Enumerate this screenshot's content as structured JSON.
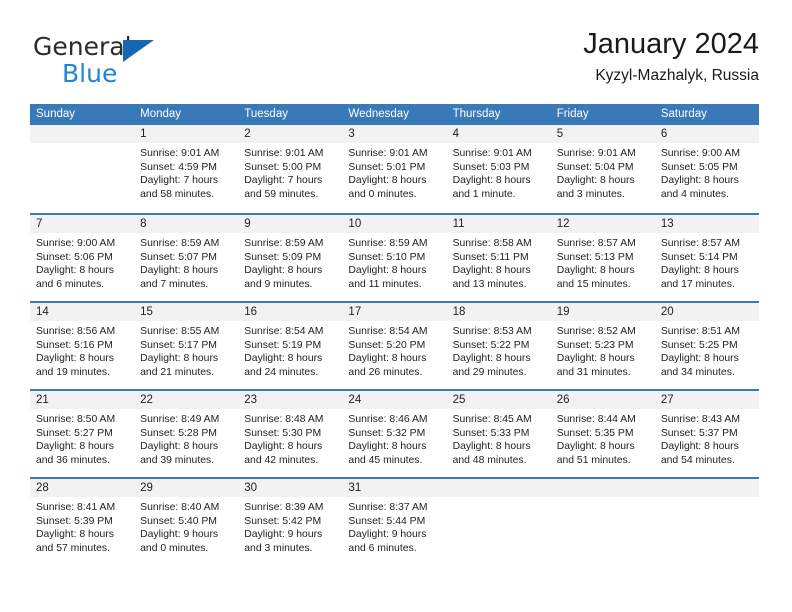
{
  "brand": {
    "name_top": "General",
    "name_bottom": "Blue",
    "triangle_color": "#1567b3",
    "blue_color": "#1f86d4"
  },
  "header": {
    "title": "January 2024",
    "subtitle": "Kyzyl-Mazhalyk, Russia"
  },
  "theme": {
    "header_bg": "#3a79b8",
    "date_band_bg": "#f2f2f2",
    "cell_bg": "#ffffff",
    "text": "#222222"
  },
  "weekdays": [
    "Sunday",
    "Monday",
    "Tuesday",
    "Wednesday",
    "Thursday",
    "Friday",
    "Saturday"
  ],
  "weeks": [
    [
      {
        "day": "",
        "lines": []
      },
      {
        "day": "1",
        "lines": [
          "Sunrise: 9:01 AM",
          "Sunset: 4:59 PM",
          "Daylight: 7 hours",
          "and 58 minutes."
        ]
      },
      {
        "day": "2",
        "lines": [
          "Sunrise: 9:01 AM",
          "Sunset: 5:00 PM",
          "Daylight: 7 hours",
          "and 59 minutes."
        ]
      },
      {
        "day": "3",
        "lines": [
          "Sunrise: 9:01 AM",
          "Sunset: 5:01 PM",
          "Daylight: 8 hours",
          "and 0 minutes."
        ]
      },
      {
        "day": "4",
        "lines": [
          "Sunrise: 9:01 AM",
          "Sunset: 5:03 PM",
          "Daylight: 8 hours",
          "and 1 minute."
        ]
      },
      {
        "day": "5",
        "lines": [
          "Sunrise: 9:01 AM",
          "Sunset: 5:04 PM",
          "Daylight: 8 hours",
          "and 3 minutes."
        ]
      },
      {
        "day": "6",
        "lines": [
          "Sunrise: 9:00 AM",
          "Sunset: 5:05 PM",
          "Daylight: 8 hours",
          "and 4 minutes."
        ]
      }
    ],
    [
      {
        "day": "7",
        "lines": [
          "Sunrise: 9:00 AM",
          "Sunset: 5:06 PM",
          "Daylight: 8 hours",
          "and 6 minutes."
        ]
      },
      {
        "day": "8",
        "lines": [
          "Sunrise: 8:59 AM",
          "Sunset: 5:07 PM",
          "Daylight: 8 hours",
          "and 7 minutes."
        ]
      },
      {
        "day": "9",
        "lines": [
          "Sunrise: 8:59 AM",
          "Sunset: 5:09 PM",
          "Daylight: 8 hours",
          "and 9 minutes."
        ]
      },
      {
        "day": "10",
        "lines": [
          "Sunrise: 8:59 AM",
          "Sunset: 5:10 PM",
          "Daylight: 8 hours",
          "and 11 minutes."
        ]
      },
      {
        "day": "11",
        "lines": [
          "Sunrise: 8:58 AM",
          "Sunset: 5:11 PM",
          "Daylight: 8 hours",
          "and 13 minutes."
        ]
      },
      {
        "day": "12",
        "lines": [
          "Sunrise: 8:57 AM",
          "Sunset: 5:13 PM",
          "Daylight: 8 hours",
          "and 15 minutes."
        ]
      },
      {
        "day": "13",
        "lines": [
          "Sunrise: 8:57 AM",
          "Sunset: 5:14 PM",
          "Daylight: 8 hours",
          "and 17 minutes."
        ]
      }
    ],
    [
      {
        "day": "14",
        "lines": [
          "Sunrise: 8:56 AM",
          "Sunset: 5:16 PM",
          "Daylight: 8 hours",
          "and 19 minutes."
        ]
      },
      {
        "day": "15",
        "lines": [
          "Sunrise: 8:55 AM",
          "Sunset: 5:17 PM",
          "Daylight: 8 hours",
          "and 21 minutes."
        ]
      },
      {
        "day": "16",
        "lines": [
          "Sunrise: 8:54 AM",
          "Sunset: 5:19 PM",
          "Daylight: 8 hours",
          "and 24 minutes."
        ]
      },
      {
        "day": "17",
        "lines": [
          "Sunrise: 8:54 AM",
          "Sunset: 5:20 PM",
          "Daylight: 8 hours",
          "and 26 minutes."
        ]
      },
      {
        "day": "18",
        "lines": [
          "Sunrise: 8:53 AM",
          "Sunset: 5:22 PM",
          "Daylight: 8 hours",
          "and 29 minutes."
        ]
      },
      {
        "day": "19",
        "lines": [
          "Sunrise: 8:52 AM",
          "Sunset: 5:23 PM",
          "Daylight: 8 hours",
          "and 31 minutes."
        ]
      },
      {
        "day": "20",
        "lines": [
          "Sunrise: 8:51 AM",
          "Sunset: 5:25 PM",
          "Daylight: 8 hours",
          "and 34 minutes."
        ]
      }
    ],
    [
      {
        "day": "21",
        "lines": [
          "Sunrise: 8:50 AM",
          "Sunset: 5:27 PM",
          "Daylight: 8 hours",
          "and 36 minutes."
        ]
      },
      {
        "day": "22",
        "lines": [
          "Sunrise: 8:49 AM",
          "Sunset: 5:28 PM",
          "Daylight: 8 hours",
          "and 39 minutes."
        ]
      },
      {
        "day": "23",
        "lines": [
          "Sunrise: 8:48 AM",
          "Sunset: 5:30 PM",
          "Daylight: 8 hours",
          "and 42 minutes."
        ]
      },
      {
        "day": "24",
        "lines": [
          "Sunrise: 8:46 AM",
          "Sunset: 5:32 PM",
          "Daylight: 8 hours",
          "and 45 minutes."
        ]
      },
      {
        "day": "25",
        "lines": [
          "Sunrise: 8:45 AM",
          "Sunset: 5:33 PM",
          "Daylight: 8 hours",
          "and 48 minutes."
        ]
      },
      {
        "day": "26",
        "lines": [
          "Sunrise: 8:44 AM",
          "Sunset: 5:35 PM",
          "Daylight: 8 hours",
          "and 51 minutes."
        ]
      },
      {
        "day": "27",
        "lines": [
          "Sunrise: 8:43 AM",
          "Sunset: 5:37 PM",
          "Daylight: 8 hours",
          "and 54 minutes."
        ]
      }
    ],
    [
      {
        "day": "28",
        "lines": [
          "Sunrise: 8:41 AM",
          "Sunset: 5:39 PM",
          "Daylight: 8 hours",
          "and 57 minutes."
        ]
      },
      {
        "day": "29",
        "lines": [
          "Sunrise: 8:40 AM",
          "Sunset: 5:40 PM",
          "Daylight: 9 hours",
          "and 0 minutes."
        ]
      },
      {
        "day": "30",
        "lines": [
          "Sunrise: 8:39 AM",
          "Sunset: 5:42 PM",
          "Daylight: 9 hours",
          "and 3 minutes."
        ]
      },
      {
        "day": "31",
        "lines": [
          "Sunrise: 8:37 AM",
          "Sunset: 5:44 PM",
          "Daylight: 9 hours",
          "and 6 minutes."
        ]
      },
      {
        "day": "",
        "lines": []
      },
      {
        "day": "",
        "lines": []
      },
      {
        "day": "",
        "lines": []
      }
    ]
  ]
}
